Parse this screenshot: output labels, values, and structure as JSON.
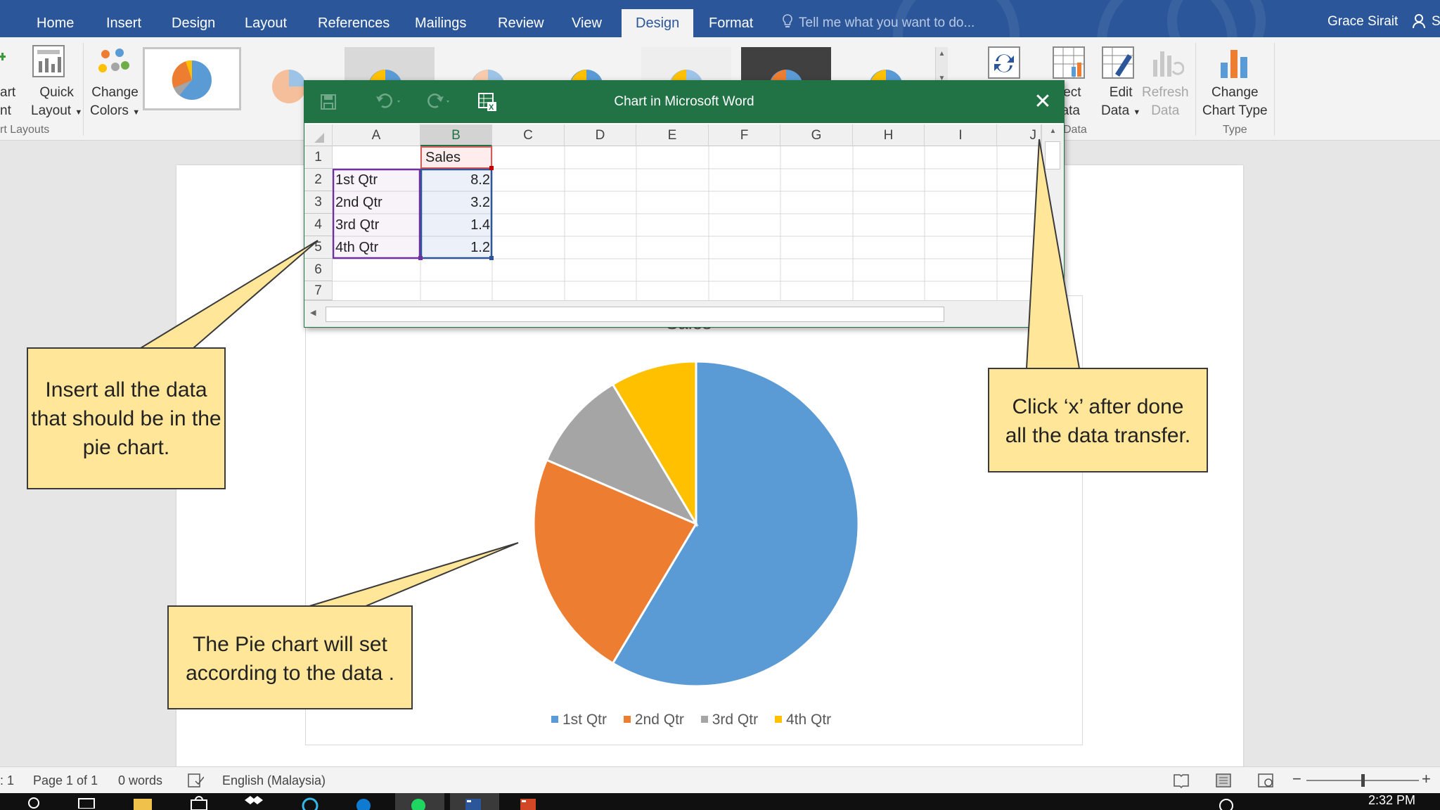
{
  "ribbon_tabs": [
    "Home",
    "Insert",
    "Design",
    "Layout",
    "References",
    "Mailings",
    "Review",
    "View",
    "Design",
    "Format"
  ],
  "active_tab_index": 8,
  "tell_me_placeholder": "Tell me what you want to do...",
  "user_name": "Grace Sirait",
  "share_label": "S",
  "ribbon": {
    "add_chart_line1": "art",
    "add_chart_line2": "nt",
    "quick_layout_line1": "Quick",
    "quick_layout_line2": "Layout",
    "change_colors_line1": "Change",
    "change_colors_line2": "Colors",
    "group_chart_layouts": "rt Layouts",
    "select_data_line1": "lect",
    "select_data_line2": "ata",
    "edit_data_line1": "Edit",
    "edit_data_line2": "Data",
    "refresh_data_line1": "Refresh",
    "refresh_data_line2": "Data",
    "group_data": "Data",
    "change_type_line1": "Change",
    "change_type_line2": "Chart Type",
    "group_type": "Type"
  },
  "excel_window": {
    "title": "Chart in Microsoft Word",
    "close_glyph": "✕",
    "columns": [
      "A",
      "B",
      "C",
      "D",
      "E",
      "F",
      "G",
      "H",
      "I",
      "J"
    ],
    "rows": [
      "1",
      "2",
      "3",
      "4",
      "5",
      "6",
      "7"
    ],
    "header_b1": "Sales",
    "data": [
      {
        "label": "1st Qtr",
        "value": "8.2"
      },
      {
        "label": "2nd Qtr",
        "value": "3.2"
      },
      {
        "label": "3rd Qtr",
        "value": "1.4"
      },
      {
        "label": "4th Qtr",
        "value": "1.2"
      }
    ]
  },
  "chart_data": {
    "type": "pie",
    "title": "Sales",
    "categories": [
      "1st Qtr",
      "2nd Qtr",
      "3rd Qtr",
      "4th Qtr"
    ],
    "values": [
      8.2,
      3.2,
      1.4,
      1.2
    ],
    "colors": [
      "#5b9bd5",
      "#ed7d31",
      "#a5a5a5",
      "#ffc000"
    ],
    "legend_position": "bottom"
  },
  "callouts": {
    "insert_data": "Insert all the data that should be in the pie chart.",
    "pie_chart": "The Pie chart will set according to the data .",
    "click_x": "Click ‘x’ after done all the data transfer."
  },
  "status_bar": {
    "section": ": 1",
    "page": "Page 1 of 1",
    "words": "0 words",
    "language": "English (Malaysia)"
  },
  "taskbar": {
    "time": "2:32 PM"
  },
  "colors": {
    "word_blue": "#2b579a",
    "excel_green": "#217346",
    "callout_yellow": "#ffe699"
  }
}
